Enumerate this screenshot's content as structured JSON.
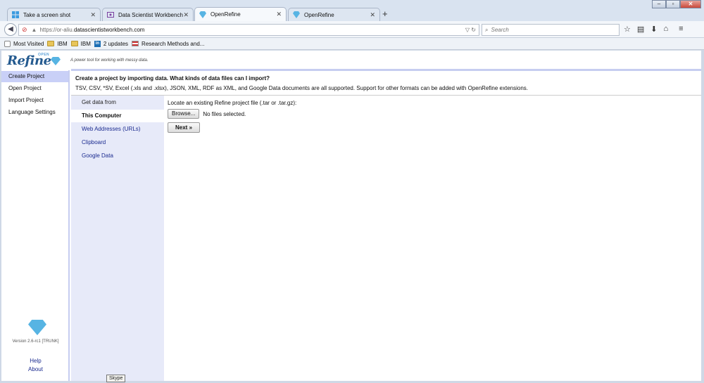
{
  "browser": {
    "tabs": [
      {
        "label": "Take a screen shot",
        "icon": "windows-icon",
        "active": false
      },
      {
        "label": "Data Scientist Workbench",
        "icon": "workbench-icon",
        "active": false
      },
      {
        "label": "OpenRefine",
        "icon": "openrefine-icon",
        "active": true
      },
      {
        "label": "OpenRefine",
        "icon": "openrefine-icon",
        "active": false
      }
    ],
    "new_tab": "+",
    "url_scheme": "https://or-aliu.",
    "url_host": "datascientistworkbench.com",
    "search_placeholder": "Search",
    "bookmarks": [
      {
        "label": "Most Visited",
        "icon": "most-visited-icon"
      },
      {
        "label": "IBM",
        "icon": "folder-icon"
      },
      {
        "label": "IBM",
        "icon": "folder-icon"
      },
      {
        "label": "2 updates",
        "icon": "linkedin-icon"
      },
      {
        "label": "Research Methods and...",
        "icon": "flag-icon"
      }
    ],
    "linkedin_glyph": "in"
  },
  "app": {
    "logo_text": "Refine",
    "logo_open": "OPEN",
    "tagline": "A power tool for working with messy data.",
    "nav": [
      {
        "label": "Create Project",
        "active": true
      },
      {
        "label": "Open Project",
        "active": false
      },
      {
        "label": "Import Project",
        "active": false
      },
      {
        "label": "Language Settings",
        "active": false
      }
    ],
    "version": "Version 2.6-rc1 [TRUNK]",
    "help": "Help",
    "about": "About"
  },
  "main": {
    "heading": "Create a project by importing data. What kinds of data files can I import?",
    "subheading": "TSV, CSV, *SV, Excel (.xls and .xlsx), JSON, XML, RDF as XML, and Google Data documents are all supported. Support for other formats can be added with OpenRefine extensions.",
    "sources_title": "Get data from",
    "sources": [
      {
        "label": "This Computer",
        "active": true
      },
      {
        "label": "Web Addresses (URLs)",
        "active": false
      },
      {
        "label": "Clipboard",
        "active": false
      },
      {
        "label": "Google Data",
        "active": false
      }
    ],
    "locate_label": "Locate an existing Refine project file (.tar or .tar.gz):",
    "browse_button": "Browse...",
    "no_files": "No files selected.",
    "next_button": "Next »"
  },
  "tooltip": "Skype"
}
